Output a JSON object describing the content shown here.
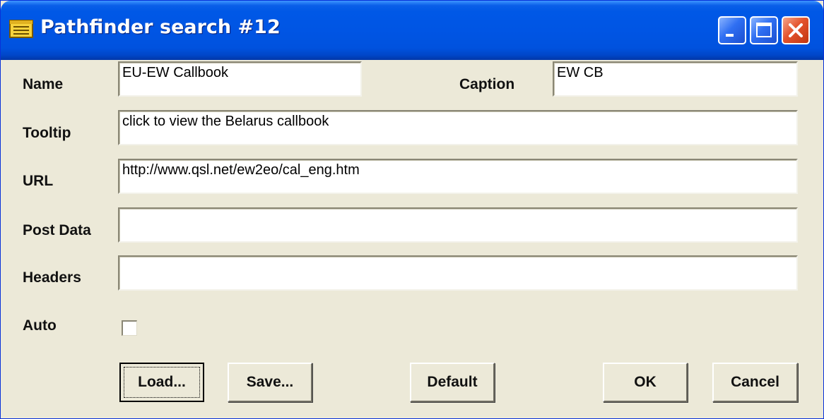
{
  "window": {
    "title": "Pathfinder search #12"
  },
  "titlebar_buttons": {
    "minimize_icon": "minimize-icon",
    "maximize_icon": "maximize-icon",
    "close_icon": "close-icon"
  },
  "form": {
    "name": {
      "label": "Name",
      "value": "EU-EW Callbook"
    },
    "caption": {
      "label": "Caption",
      "value": "EW CB"
    },
    "tooltip": {
      "label": "Tooltip",
      "value": "click to view the Belarus callbook"
    },
    "url": {
      "label": "URL",
      "value": "http://www.qsl.net/ew2eo/cal_eng.htm"
    },
    "post_data": {
      "label": "Post Data",
      "value": ""
    },
    "headers": {
      "label": "Headers",
      "value": ""
    },
    "auto": {
      "label": "Auto",
      "checked": false
    }
  },
  "buttons": {
    "load": "Load...",
    "save": "Save...",
    "default": "Default",
    "ok": "OK",
    "cancel": "Cancel"
  },
  "colors": {
    "titlebar": "#0055e4",
    "dialog_background": "#ece9d8",
    "close_button": "#e3532d"
  }
}
